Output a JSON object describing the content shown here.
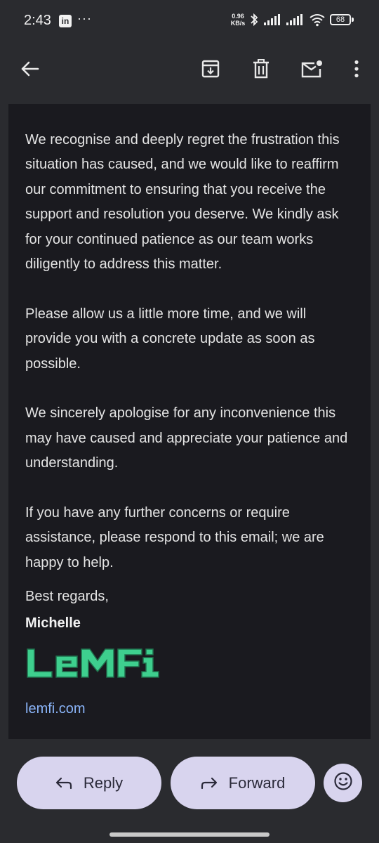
{
  "status_bar": {
    "time": "2:43",
    "net_speed_value": "0.96",
    "net_speed_unit": "KB/s",
    "battery": "68",
    "more_indicator": "···",
    "linkedin_letter": "in"
  },
  "toolbar": {
    "icons": [
      "back-arrow-icon",
      "archive-icon",
      "delete-icon",
      "mark-unread-icon",
      "more-vert-icon"
    ]
  },
  "email": {
    "paragraphs": [
      "We recognise and deeply regret the frustration this situation has caused, and we would like to reaffirm our commitment to ensuring that you receive the support and resolution you deserve. We kindly ask for your continued patience as our team works diligently to address this matter.",
      "Please allow us a little more time, and we will provide you with a concrete update as soon as possible.",
      "We sincerely apologise for any inconvenience this may have caused and appreciate your patience and understanding.",
      "If you have any further concerns or require assistance, please respond to this email; we are happy to help."
    ],
    "closing": "Best regards,",
    "signer": "Michelle",
    "logo_text": "LEMFi",
    "link": "lemfi.com"
  },
  "actions": {
    "reply_label": "Reply",
    "forward_label": "Forward"
  },
  "colors": {
    "background": "#2a2b2f",
    "card": "#1a1a1f",
    "link": "#8ab4f8",
    "logo_green": "#3ecf8e",
    "button_bg": "#d8d4ee"
  }
}
